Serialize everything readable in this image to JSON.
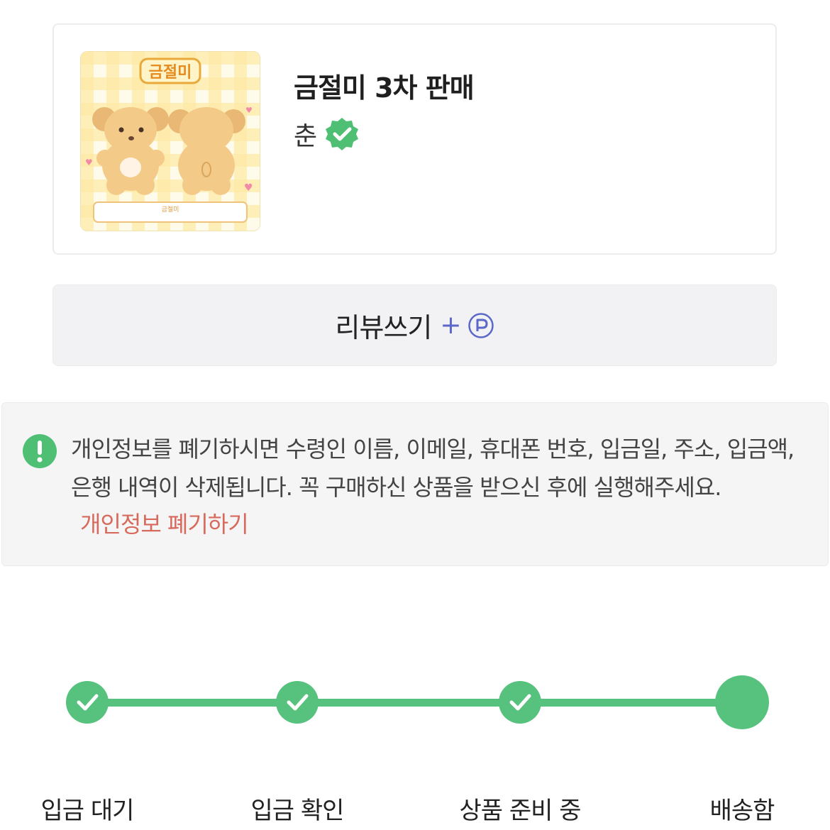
{
  "product": {
    "title": "금절미 3차 판매",
    "seller": "춘",
    "thumbnail": {
      "logo_text": "금절미",
      "caption": "금절미"
    }
  },
  "review": {
    "label": "리뷰쓰기",
    "plus": "+"
  },
  "notice": {
    "text": "개인정보를 폐기하시면 수령인 이름, 이메일, 휴대폰 번호, 입금일, 주소, 입금액, 은행 내역이 삭제됩니다. 꼭 구매하신 상품을 받으신 후에 실행해주세요.",
    "link": "개인정보 폐기하기"
  },
  "progress": {
    "steps": [
      {
        "label": "입금 대기",
        "state": "done"
      },
      {
        "label": "입금 확인",
        "state": "done"
      },
      {
        "label": "상품 준비 중",
        "state": "done"
      },
      {
        "label": "배송함",
        "state": "current"
      }
    ]
  },
  "colors": {
    "accent_green": "#57c27d",
    "link_red": "#d86a5d",
    "point_blue": "#5b67c9"
  }
}
